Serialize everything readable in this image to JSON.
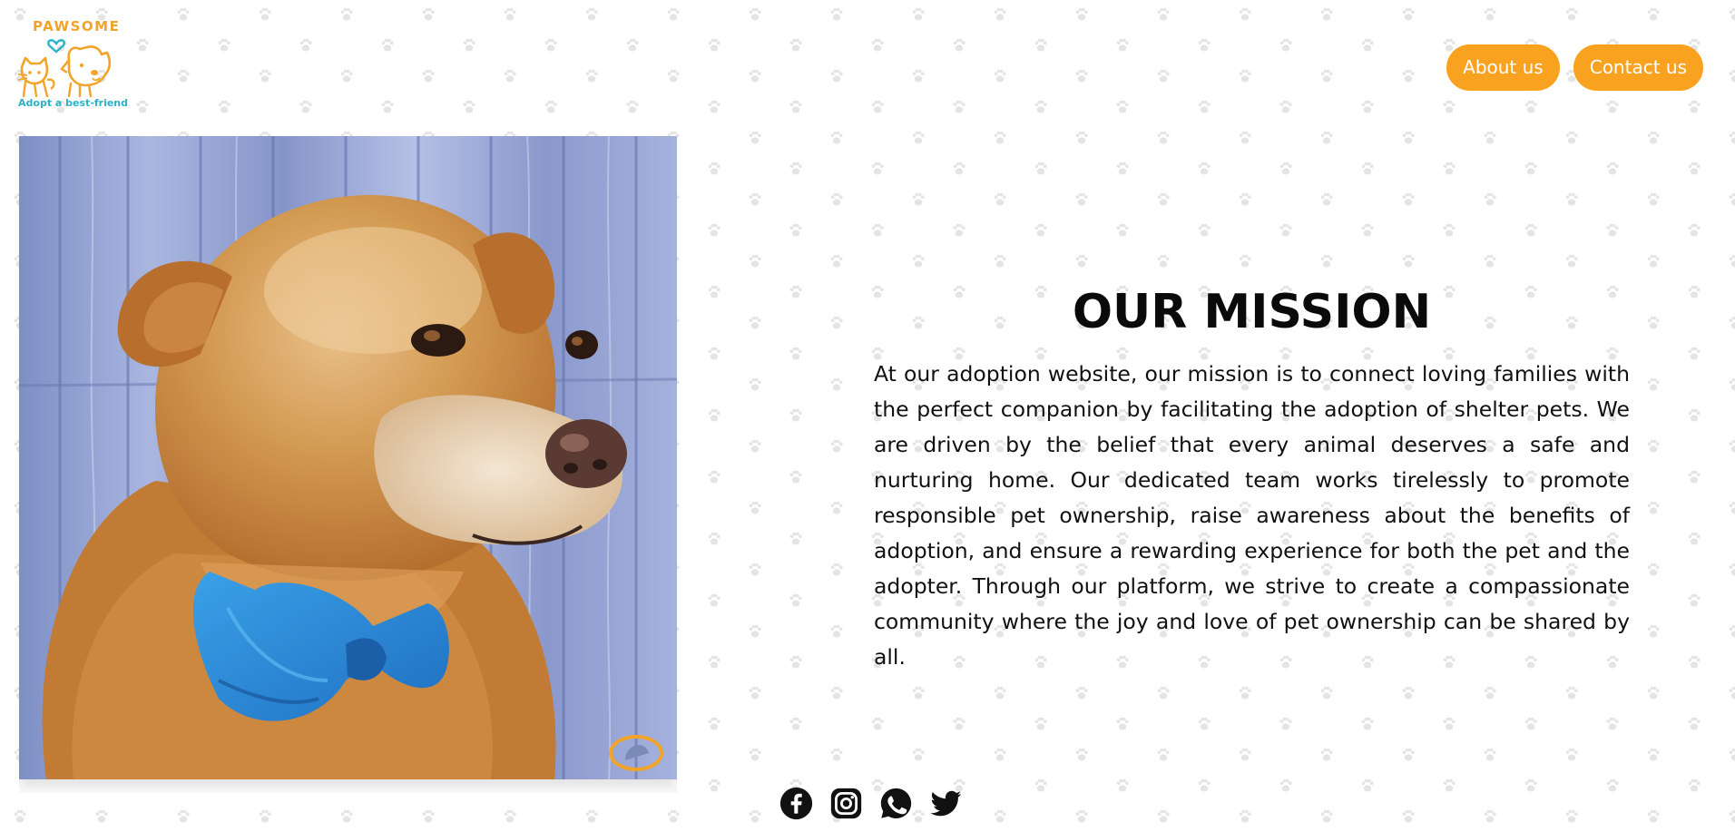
{
  "logo": {
    "brand": "PAWSOME",
    "tagline": "Adopt a best-friend",
    "icon": "cat-dog-heart-logo"
  },
  "nav": {
    "about_label": "About us",
    "contact_label": "Contact us"
  },
  "hero_image": {
    "alt": "golden dog with blue bow tie"
  },
  "mission": {
    "title": "OUR MISSION",
    "body": "At our adoption website, our mission is to connect loving families with the perfect companion by facilitating the adoption of shelter pets. We are driven by the belief that every animal deserves a safe and nurturing home. Our dedicated team works tirelessly to promote responsible pet ownership, raise awareness about the benefits of adoption, and ensure a rewarding experience for both the pet and the adopter. Through our platform, we strive to create a compassionate community where the joy and love of pet ownership can be shared by all."
  },
  "socials": [
    {
      "name": "facebook-icon"
    },
    {
      "name": "instagram-icon"
    },
    {
      "name": "whatsapp-icon"
    },
    {
      "name": "twitter-icon"
    }
  ],
  "colors": {
    "accent": "#f9a21f",
    "logo_orange": "#f2a42a",
    "logo_teal": "#2bb3c6",
    "text": "#111111"
  }
}
